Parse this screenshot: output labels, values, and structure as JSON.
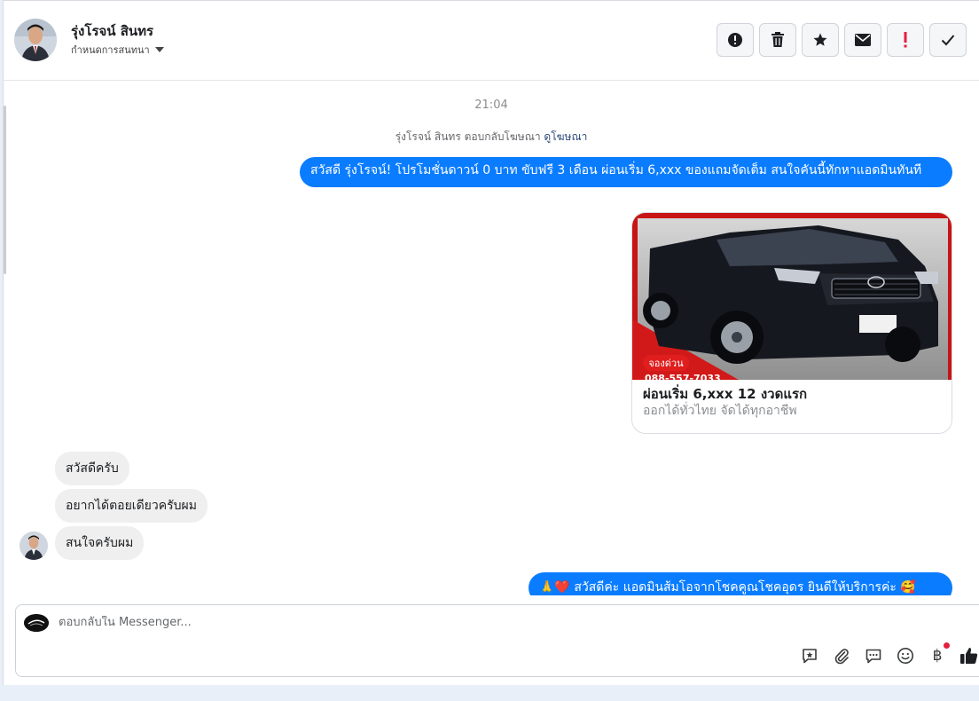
{
  "header": {
    "contact_name": "รุ่งโรจน์ สินทร",
    "assign_label": "กำหนดการสนทนา"
  },
  "chat": {
    "timestamp": "21:04",
    "ad_reply_text": "รุ่งโรจน์ สินทร ตอบกลับโฆษณา",
    "ad_reply_link": "ดูโฆษณา",
    "outgoing_1": "สวัสดี รุ่งโรจน์! โปรโมชั่นดาวน์ 0 บาท ขับฟรี 3 เดือน ผ่อนเริ่ม 6,xxx ของแถมจัดเต็ม สนใจคันนี้ทักหาแอดมินทันที",
    "card": {
      "badge": "จองด่วน",
      "phone": "088-557-7033",
      "title": "ผ่อนเริ่ม 6,xxx 12 งวดแรก",
      "subtitle": "ออกได้ทั่วไทย จัดได้ทุกอาชีพ"
    },
    "incoming": [
      "สวัสดีครับ",
      "อยากได้ตอยเดียวครับผม",
      "สนใจครับผม"
    ],
    "outgoing_2": "🙏❤️ สวัสดีค่ะ แอดมินส้มโอจากโชคคูณโชคอุดร ยินดีให้บริการค่ะ 🥰"
  },
  "composer": {
    "placeholder": "ตอบกลับใน Messenger...",
    "baht_symbol": "฿"
  },
  "colors": {
    "outgoing_bubble": "#0a7cff",
    "incoming_bubble": "#efefef",
    "link": "#2c4a78",
    "alert_red": "#e41e3f"
  }
}
